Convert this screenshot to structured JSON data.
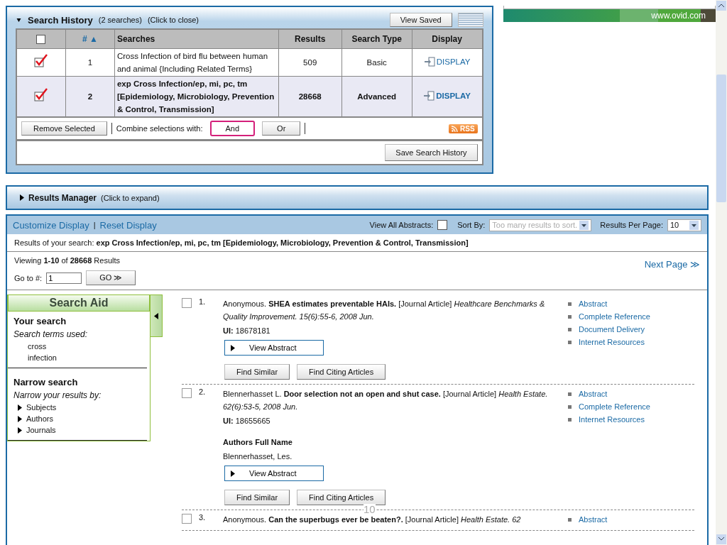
{
  "search_history": {
    "title": "Search History",
    "count": "(2 searches)",
    "hint": "(Click to close)",
    "view_saved": "View Saved",
    "columns": [
      {
        "kind": "checkbox",
        "checked": false
      },
      {
        "label": "#",
        "kind": "sort",
        "sort_icon": "▲"
      },
      {
        "label": "Searches",
        "kind": "text"
      },
      {
        "label": "Results",
        "kind": "text"
      },
      {
        "label": "Search Type",
        "kind": "text"
      },
      {
        "label": "Display",
        "kind": "text"
      }
    ],
    "rows": [
      {
        "checked": true,
        "current": false,
        "number": "1",
        "search": "Cross Infection of bird flu between human and animal {Including Related Terms}",
        "results": "509",
        "type": "Basic",
        "display": "DISPLAY"
      },
      {
        "checked": true,
        "current": true,
        "number": "2",
        "search": "exp Cross Infection/ep, mi, pc, tm [Epidemiology, Microbiology, Prevention & Control, Transmission]",
        "results": "28668",
        "type": "Advanced",
        "display": "DISPLAY"
      }
    ],
    "remove": "Remove Selected",
    "combine_label": "Combine selections with:",
    "combine": [
      {
        "label": "And",
        "selected": true
      },
      {
        "label": "Or",
        "selected": false
      }
    ],
    "rss": "RSS",
    "save": "Save Search History"
  },
  "banner": {
    "url": "www.ovid.com"
  },
  "results_manager": {
    "title": "Results Manager",
    "hint": "(Click to expand)"
  },
  "results": {
    "customize": "Customize Display",
    "separator": "|",
    "reset": "Reset Display",
    "view_all_label": "View All Abstracts:",
    "view_all_checked": false,
    "sort_label": "Sort By:",
    "sort_placeholder": "Too many results to sort.",
    "per_page_label": "Results Per Page:",
    "per_page": "10",
    "query": "Results of your search: **exp Cross Infection/ep, mi, pc, tm [Epidemiology, Microbiology, Prevention & Control, Transmission]**",
    "viewing": "Viewing **1-10** of **28668** Results",
    "next": "Next Page ≫",
    "goto_label": "Go to #:",
    "goto_value": "1",
    "go": "GO ≫",
    "search_aid": {
      "title": "Search Aid",
      "your_search": "Your search",
      "terms_label": "Search terms used:",
      "terms": [
        "cross",
        "infection"
      ],
      "narrow": "Narrow search",
      "narrow_label": "Narrow your results by:",
      "facets": [
        "Subjects",
        "Authors",
        "Journals"
      ]
    },
    "items": [
      {
        "checked": false,
        "number": "1.",
        "citation": "Anonymous. **SHEA estimates preventable HAIs.** [Journal Article] *Healthcare Benchmarks & Quality Improvement. 15(6):55-6, 2008 Jun.*",
        "ui": "**UI:** 18678181",
        "view_abstract": "View Abstract",
        "buttons": [
          "Find Similar",
          "Find Citing Articles"
        ],
        "links": [
          "Abstract",
          "Complete Reference",
          "Document Delivery",
          "Internet Resources"
        ]
      },
      {
        "checked": false,
        "number": "2.",
        "citation": "Blennerhasset L. **Door selection not an open and shut case.** [Journal Article] *Health Estate. 62(6):53-5, 2008 Jun.*",
        "ui": "**UI:** 18655665",
        "authors_heading": "Authors Full Name",
        "authors": "Blennerhasset, Les.",
        "view_abstract": "View Abstract",
        "buttons": [
          "Find Similar",
          "Find Citing Articles"
        ],
        "links": [
          "Abstract",
          "Complete Reference",
          "Internet Resources"
        ]
      },
      {
        "checked": false,
        "number": "3.",
        "citation": "Anonymous. **Can the superbugs ever be beaten?.** [Journal Article] *Health Estate. 62*",
        "links": [
          "Abstract"
        ]
      }
    ]
  },
  "page_number": "10"
}
